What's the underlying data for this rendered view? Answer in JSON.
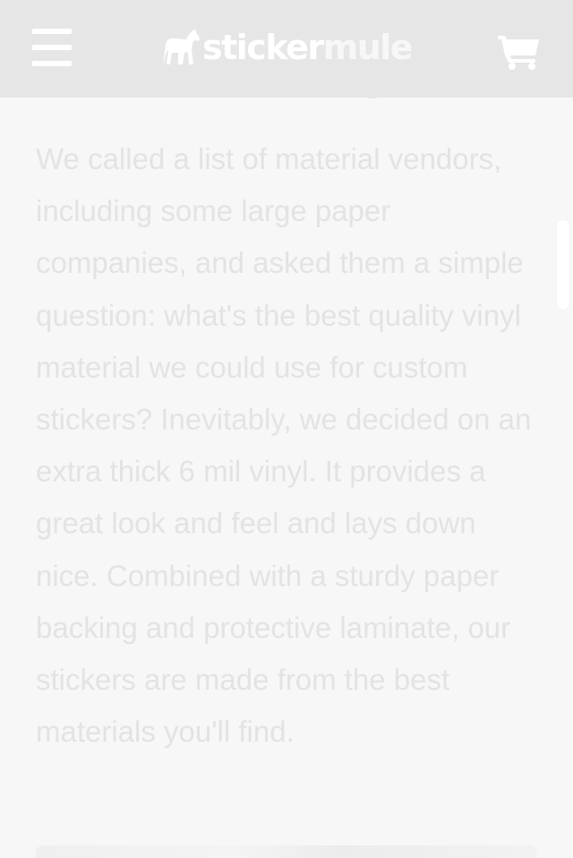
{
  "header": {
    "logo": {
      "part1": "sticker",
      "part2": "mule"
    },
    "icons": {
      "menu": "hamburger-menu-icon",
      "cart": "shopping-cart-icon",
      "logo_mark": "mule-icon"
    }
  },
  "article": {
    "paragraph": "We called a list of material vendors, including some large paper companies, and asked them a simple question: what's the best quality vinyl material we could use for custom stickers? Inevitably, we decided on an extra thick 6 mil vinyl. It provides a great look and feel and lays down nice. Combined with a sturdy paper backing and protective laminate, our stickers are made from the best materials you'll find."
  },
  "colors": {
    "header_bg": "#e6e6e6",
    "page_bg": "#f7f7f7",
    "text": "#e3e3e3"
  }
}
